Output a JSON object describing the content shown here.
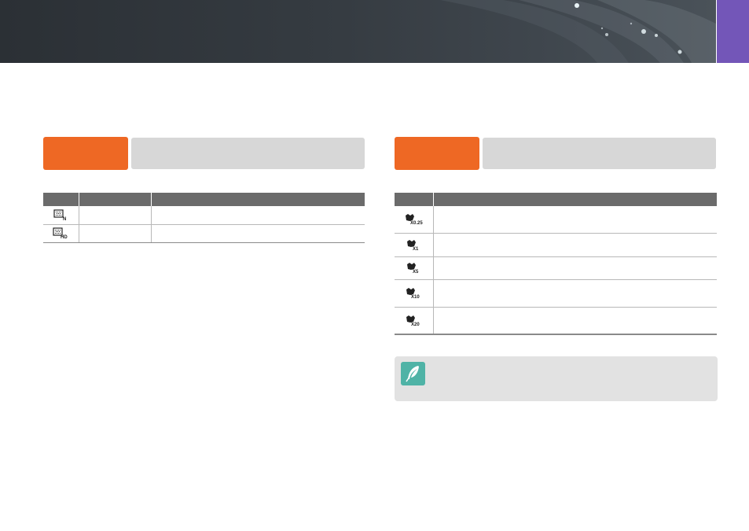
{
  "colors": {
    "banner": "#353b41",
    "side_tab": "#7356b8",
    "section_tag": "#ee6824",
    "section_bar": "#d7d7d7",
    "table_header": "#6b6b6b",
    "note_bg": "#e2e2e2",
    "note_icon": "#4fb3a6"
  },
  "left_section": {
    "icons": [
      "quality-normal-icon",
      "quality-hd-icon"
    ],
    "rows": [
      {
        "icon": "quality-normal-icon",
        "badge": "N"
      },
      {
        "icon": "quality-hd-icon",
        "badge": "HD"
      }
    ]
  },
  "right_section": {
    "rows": [
      {
        "icon": "speed-x025-icon",
        "badge": "X0.25"
      },
      {
        "icon": "speed-x1-icon",
        "badge": "X1"
      },
      {
        "icon": "speed-x5-icon",
        "badge": "X5"
      },
      {
        "icon": "speed-x10-icon",
        "badge": "X10"
      },
      {
        "icon": "speed-x20-icon",
        "badge": "X20"
      }
    ]
  },
  "note": {
    "icon": "note-pen-icon"
  }
}
